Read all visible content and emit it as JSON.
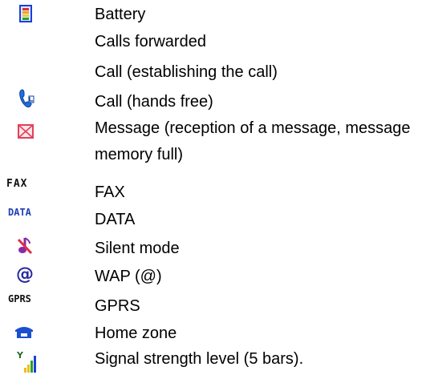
{
  "items": [
    {
      "icon": "battery-icon",
      "label": "Battery"
    },
    {
      "icon": "",
      "label": "Calls forwarded"
    },
    {
      "icon": "",
      "label": "Call (establishing the call)"
    },
    {
      "icon": "handset-icon",
      "label": "Call (hands free)"
    },
    {
      "icon": "envelope-icon",
      "label": "Message (reception of a message, message memory full)"
    },
    {
      "icon": "fax-icon",
      "label": "FAX",
      "icon_text": "FAX"
    },
    {
      "icon": "data-icon",
      "label": "DATA",
      "icon_text": "DATA"
    },
    {
      "icon": "silent-mode-icon",
      "label": "Silent mode"
    },
    {
      "icon": "wap-at-icon",
      "label": "WAP (@)",
      "icon_text": "@"
    },
    {
      "icon": "gprs-icon",
      "label": "GPRS",
      "icon_text": "GPRS"
    },
    {
      "icon": "home-zone-icon",
      "label": "Home zone"
    },
    {
      "icon": "signal-strength-icon",
      "label": "Signal strength level (5 bars).",
      "icon_text": "Y"
    }
  ],
  "colors": {
    "text": "#000000",
    "battery_frame": "#1a3fd6",
    "handset": "#1f6fe0",
    "envelope": "#e0405a",
    "icon_text": "#111111",
    "data_text": "#1f3fb8",
    "silent_note": "#8a2aa6",
    "wap": "#2a2aa0",
    "home": "#1a4fd0",
    "signal_yellow": "#e8c01a",
    "signal_green": "#2aa02a",
    "signal_blue": "#1f3fd6"
  }
}
